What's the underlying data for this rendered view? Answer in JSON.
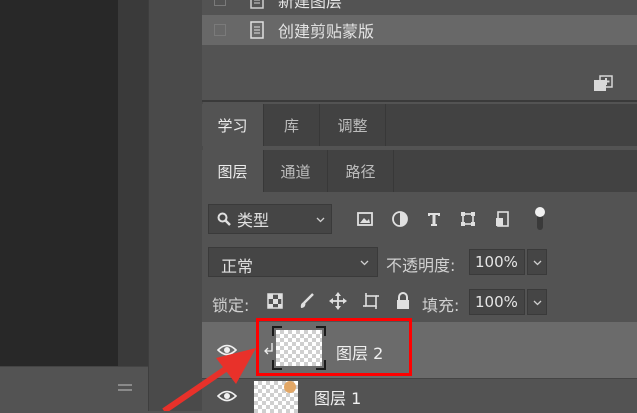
{
  "history": {
    "items": [
      {
        "label": "新建图层"
      },
      {
        "label": "创建剪贴蒙版"
      }
    ]
  },
  "top_tabs": [
    {
      "label": "学习"
    },
    {
      "label": "库"
    },
    {
      "label": "调整"
    }
  ],
  "panel_tabs": [
    {
      "label": "图层"
    },
    {
      "label": "通道"
    },
    {
      "label": "路径"
    }
  ],
  "filter": {
    "kind_label": "类型",
    "icons": [
      "image-filter-icon",
      "adjustment-filter-icon",
      "type-filter-icon",
      "shape-filter-icon",
      "smart-object-filter-icon",
      "filter-toggle-icon"
    ]
  },
  "blend": {
    "mode": "正常",
    "opacity_label": "不透明度:",
    "opacity_value": "100%"
  },
  "lock": {
    "label": "锁定:",
    "fill_label": "填充:",
    "fill_value": "100%",
    "icons": [
      "lock-transparent-icon",
      "lock-image-icon",
      "lock-position-icon",
      "lock-artboard-icon",
      "lock-all-icon"
    ]
  },
  "layers": [
    {
      "name": "图层 2",
      "selected": true,
      "clipped": true
    },
    {
      "name": "图层 1",
      "selected": false
    }
  ],
  "colors": {
    "highlight": "#ff0000",
    "arrow": "#e8312a",
    "selected_row": "#6b6b6b"
  }
}
